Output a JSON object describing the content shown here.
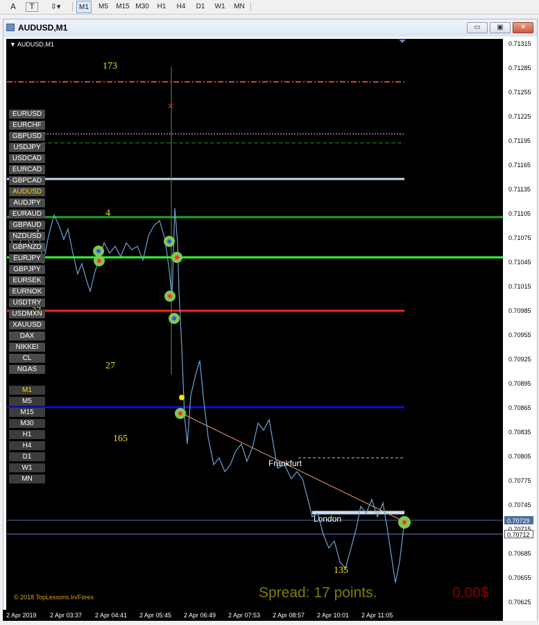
{
  "toolbar": {
    "tools": [
      {
        "label": "A",
        "name": "text-tool"
      },
      {
        "label": "T",
        "name": "text-label-tool"
      },
      {
        "label": "⇳▾",
        "name": "arrows-tool"
      }
    ],
    "timeframes": [
      "M1",
      "M5",
      "M15",
      "M30",
      "H1",
      "H4",
      "D1",
      "W1",
      "MN"
    ],
    "active_timeframe": "M1"
  },
  "window": {
    "title": "AUDUSD,M1",
    "controls": {
      "minimize": "▭",
      "maximize": "▣",
      "close": "✕"
    }
  },
  "chart": {
    "symbol_label": "AUDUSD,M1",
    "price_labels": [
      "0.71315",
      "0.71285",
      "0.71255",
      "0.71225",
      "0.71195",
      "0.71165",
      "0.71135",
      "0.71105",
      "0.71075",
      "0.71045",
      "0.71015",
      "0.70985",
      "0.70955",
      "0.70925",
      "0.70895",
      "0.70865",
      "0.70835",
      "0.70805",
      "0.70775",
      "0.70745",
      "0.70715",
      "0.70685",
      "0.70655",
      "0.70625"
    ],
    "price_tags": [
      {
        "value": "0.70729",
        "color": "#4f6ea0"
      },
      {
        "value": "0.70712",
        "color": "#8a6fd1"
      }
    ],
    "time_labels": [
      "2 Apr 2019",
      "2 Apr 03:37",
      "2 Apr 04:41",
      "2 Apr 05:45",
      "2 Apr 06:49",
      "2 Apr 07:53",
      "2 Apr 08:57",
      "2 Apr 10:01",
      "2 Apr 11:05"
    ],
    "symbols": [
      "EURUSD",
      "EURCHF",
      "GBPUSD",
      "USDJPY",
      "USDCAD",
      "EURCAD",
      "GBPCAD",
      "AUDUSD",
      "AUDJPY",
      "EURAUD",
      "GBPAUD",
      "NZDUSD",
      "GBPNZD",
      "EURJPY",
      "GBPJPY",
      "EURSEK",
      "EURNOK",
      "USDTRY",
      "USDMXN",
      "XAUUSD",
      "DAX",
      "NIKKEI",
      "CL",
      "NGAS"
    ],
    "active_symbol": "AUDUSD",
    "timeframes": [
      "M1",
      "M5",
      "M15",
      "M30",
      "H1",
      "H4",
      "D1",
      "W1",
      "MN"
    ],
    "active_timeframe": "M1",
    "level_numbers": [
      "173",
      "4",
      "39",
      "27",
      "165",
      "135"
    ],
    "sessions": [
      "Frankfurt",
      "London"
    ],
    "spread_text": "Spread: 17 points.",
    "profit_text": "0.00$",
    "copyright": "© 2018 TopLessons.In/Forex",
    "colors": {
      "background": "#000000",
      "price_line": "#6fa4d6",
      "green_level": "#1faa1f",
      "bright_green_level": "#33ff33",
      "red_level": "#ff2020",
      "blue_level": "#1010d0",
      "white_level": "#c8dcec",
      "yellow_text": "#f5e400",
      "spread": "#7f8000",
      "profit": "#8b0000"
    }
  }
}
